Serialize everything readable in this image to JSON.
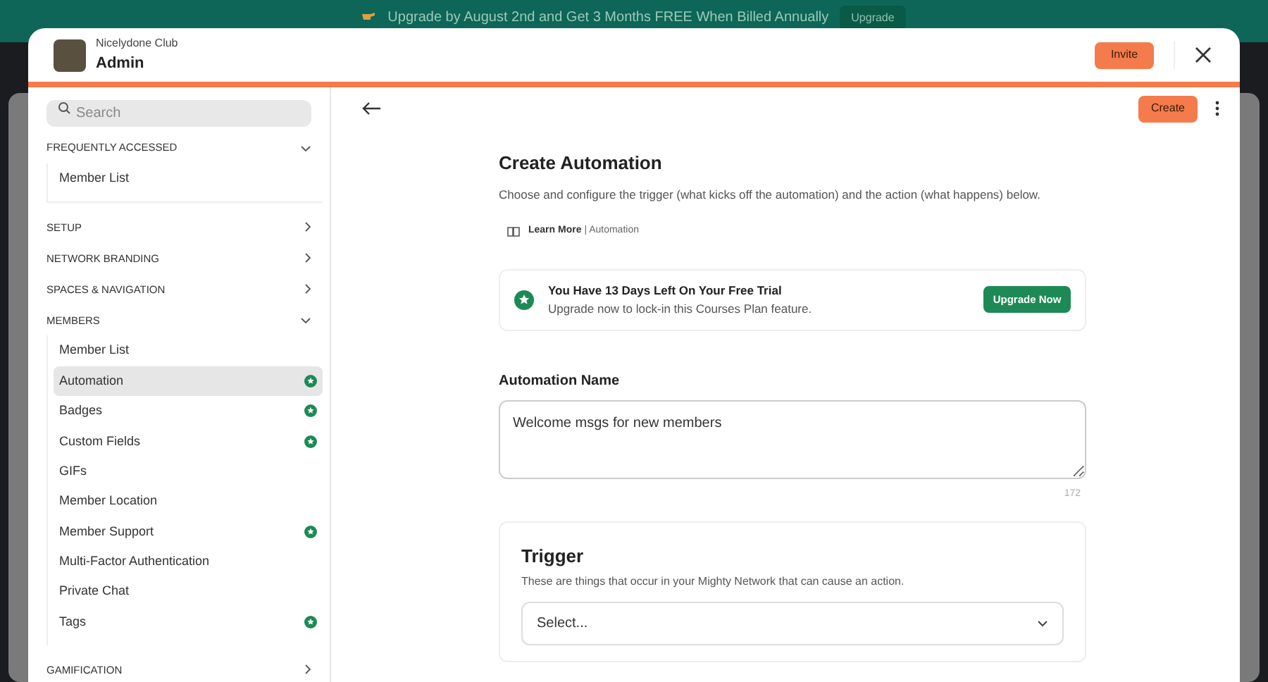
{
  "banner": {
    "text": "Upgrade by August 2nd and Get 3 Months FREE When Billed Annually",
    "button": "Upgrade"
  },
  "header": {
    "network": "Nicelydone Club",
    "title": "Admin",
    "invite": "Invite"
  },
  "sidebar": {
    "search": {
      "placeholder": "Search"
    },
    "sections": [
      {
        "label": "FREQUENTLY ACCESSED",
        "expanded": true,
        "items": [
          {
            "label": "Member List",
            "selected": false,
            "premium": false
          }
        ]
      },
      {
        "label": "SETUP",
        "expanded": false
      },
      {
        "label": "NETWORK BRANDING",
        "expanded": false
      },
      {
        "label": "SPACES & NAVIGATION",
        "expanded": false
      },
      {
        "label": "MEMBERS",
        "expanded": true,
        "items": [
          {
            "label": "Member List",
            "selected": false,
            "premium": false
          },
          {
            "label": "Automation",
            "selected": true,
            "premium": true
          },
          {
            "label": "Badges",
            "selected": false,
            "premium": true
          },
          {
            "label": "Custom Fields",
            "selected": false,
            "premium": true
          },
          {
            "label": "GIFs",
            "selected": false,
            "premium": false
          },
          {
            "label": "Member Location",
            "selected": false,
            "premium": false
          },
          {
            "label": "Member Support",
            "selected": false,
            "premium": true
          },
          {
            "label": "Multi-Factor Authentication",
            "selected": false,
            "premium": false
          },
          {
            "label": "Private Chat",
            "selected": false,
            "premium": false
          },
          {
            "label": "Tags",
            "selected": false,
            "premium": true
          }
        ]
      },
      {
        "label": "GAMIFICATION",
        "expanded": false
      }
    ]
  },
  "toolbar": {
    "create": "Create"
  },
  "page": {
    "title": "Create Automation",
    "description": "Choose and configure the trigger (what kicks off the automation) and the action (what happens) below.",
    "learn_more": "Learn More",
    "learn_topic": "| Automation"
  },
  "trial": {
    "title": "You Have 13 Days Left On Your Free Trial",
    "subtitle": "Upgrade now to lock-in this Courses Plan feature.",
    "button": "Upgrade Now"
  },
  "name_field": {
    "label": "Automation Name",
    "value": "Welcome msgs for new members",
    "counter": "172"
  },
  "trigger": {
    "title": "Trigger",
    "description": "These are things that occur in your Mighty Network that can cause an action.",
    "select": "Select..."
  }
}
